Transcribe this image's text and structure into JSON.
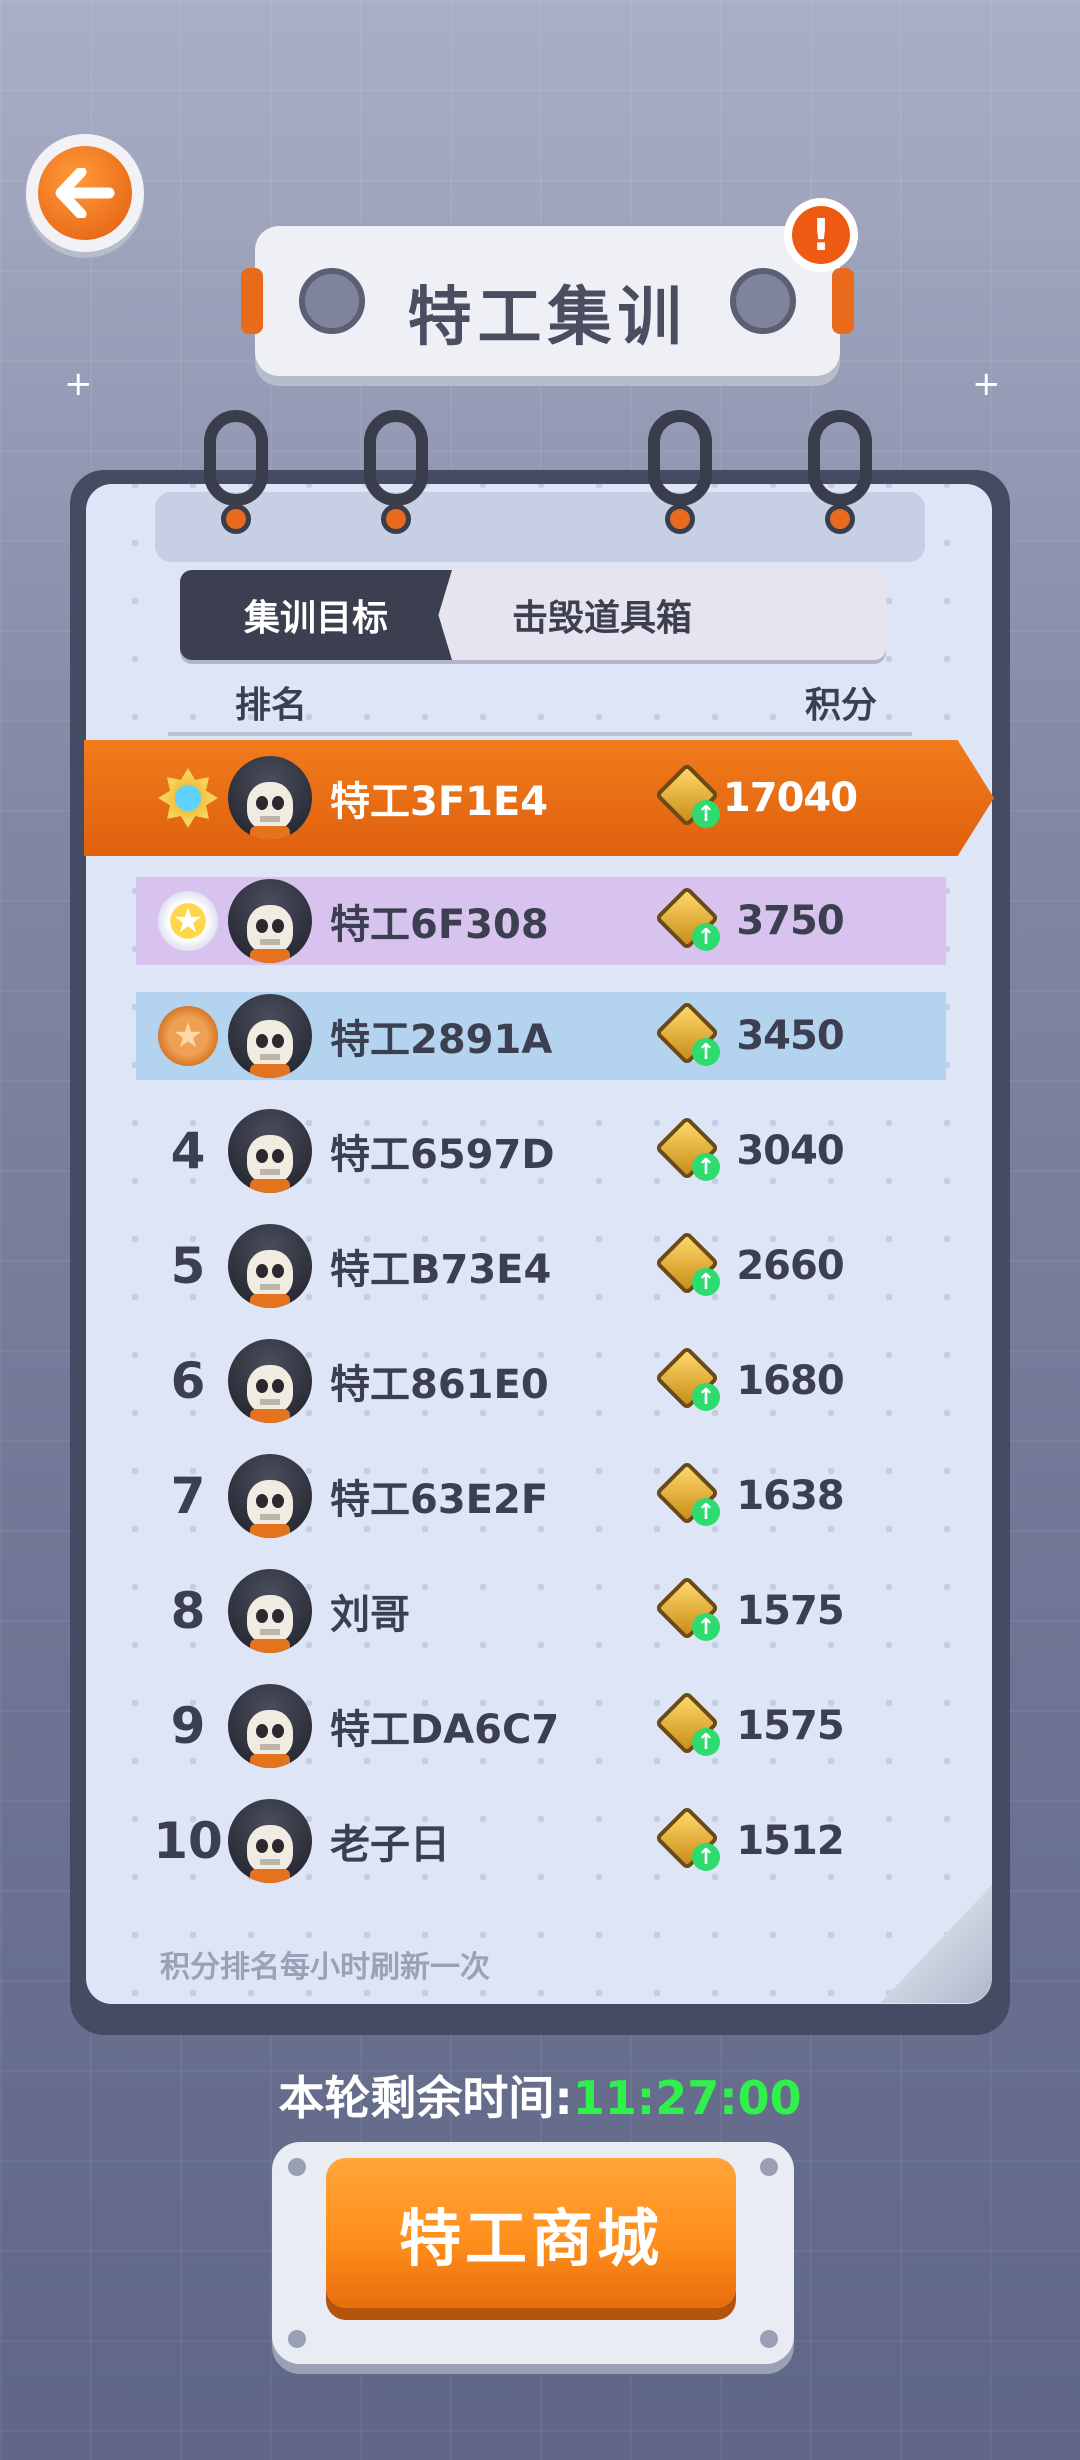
{
  "header": {
    "title": "特工集训"
  },
  "tabs": [
    {
      "label": "集训目标",
      "active": true
    },
    {
      "label": "击毁道具箱",
      "active": false
    }
  ],
  "columns": {
    "rank": "排名",
    "score": "积分"
  },
  "leaderboard": [
    {
      "rank": "1",
      "name": "特工3F1E4",
      "score": "17040",
      "medal": "diamond"
    },
    {
      "rank": "2",
      "name": "特工6F308",
      "score": "3750",
      "medal": "gold"
    },
    {
      "rank": "3",
      "name": "特工2891A",
      "score": "3450",
      "medal": "bronze"
    },
    {
      "rank": "4",
      "name": "特工6597D",
      "score": "3040"
    },
    {
      "rank": "5",
      "name": "特工B73E4",
      "score": "2660"
    },
    {
      "rank": "6",
      "name": "特工861E0",
      "score": "1680"
    },
    {
      "rank": "7",
      "name": "特工63E2F",
      "score": "1638"
    },
    {
      "rank": "8",
      "name": "刘哥",
      "score": "1575"
    },
    {
      "rank": "9",
      "name": "特工DA6C7",
      "score": "1575"
    },
    {
      "rank": "10",
      "name": "老子日",
      "score": "1512"
    }
  ],
  "refresh_note": "积分排名每小时刷新一次",
  "timer": {
    "label": "本轮剩余时间:",
    "value": "11:27:00"
  },
  "shop_button": {
    "label": "特工商城"
  },
  "colors": {
    "accent": "#f07c1b",
    "timer": "#30f04a",
    "row2": "#d8c3ee",
    "row3": "#b3d3ef"
  },
  "icons": {
    "back": "back-arrow-icon",
    "alert": "exclamation-icon",
    "points": "coin-upgrade-icon"
  }
}
